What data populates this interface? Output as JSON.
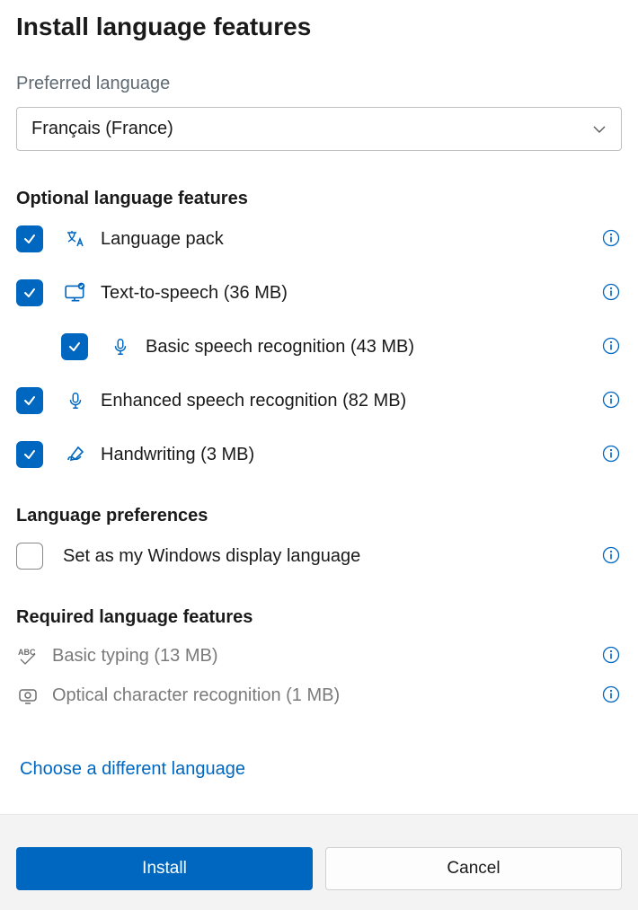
{
  "title": "Install language features",
  "preferred": {
    "label": "Preferred language",
    "value": "Français (France)"
  },
  "optional": {
    "heading": "Optional language features",
    "items": [
      {
        "id": "language-pack",
        "label": "Language pack",
        "checked": true
      },
      {
        "id": "text-to-speech",
        "label": "Text-to-speech (36 MB)",
        "checked": true
      },
      {
        "id": "basic-speech",
        "label": "Basic speech recognition (43 MB)",
        "checked": true,
        "indent": true
      },
      {
        "id": "enhanced-speech",
        "label": "Enhanced speech recognition (82 MB)",
        "checked": true
      },
      {
        "id": "handwriting",
        "label": "Handwriting (3 MB)",
        "checked": true
      }
    ]
  },
  "preferences": {
    "heading": "Language preferences",
    "items": [
      {
        "id": "display-language",
        "label": "Set as my Windows display language",
        "checked": false
      }
    ]
  },
  "required": {
    "heading": "Required language features",
    "items": [
      {
        "id": "basic-typing",
        "label": "Basic typing (13 MB)"
      },
      {
        "id": "ocr",
        "label": "Optical character recognition (1 MB)"
      }
    ]
  },
  "link": "Choose a different language",
  "buttons": {
    "install": "Install",
    "cancel": "Cancel"
  },
  "colors": {
    "accent": "#0067c0",
    "info": "#0067c0"
  }
}
